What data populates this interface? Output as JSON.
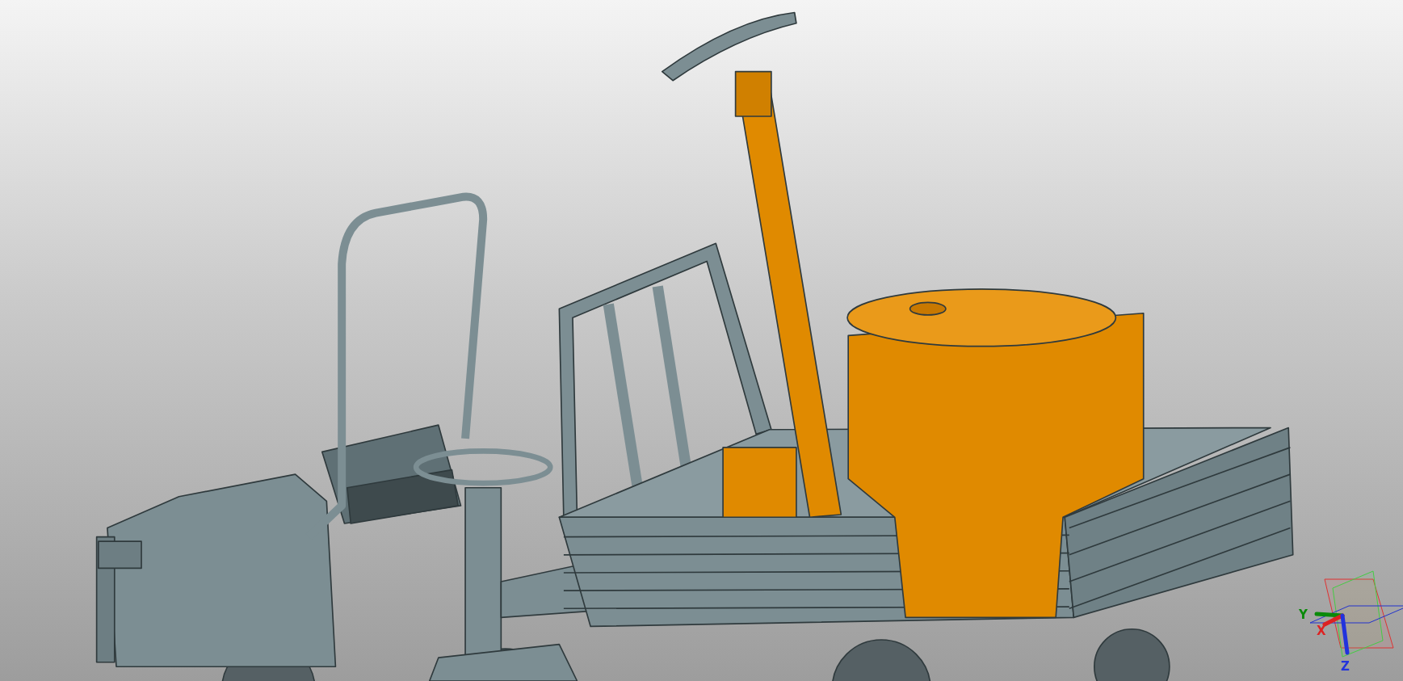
{
  "viewport": {
    "triad": {
      "axes": [
        {
          "label": "Y",
          "color": "#0a8a0a"
        },
        {
          "label": "X",
          "color": "#dd2222"
        },
        {
          "label": "Z",
          "color": "#2233dd"
        }
      ]
    }
  }
}
